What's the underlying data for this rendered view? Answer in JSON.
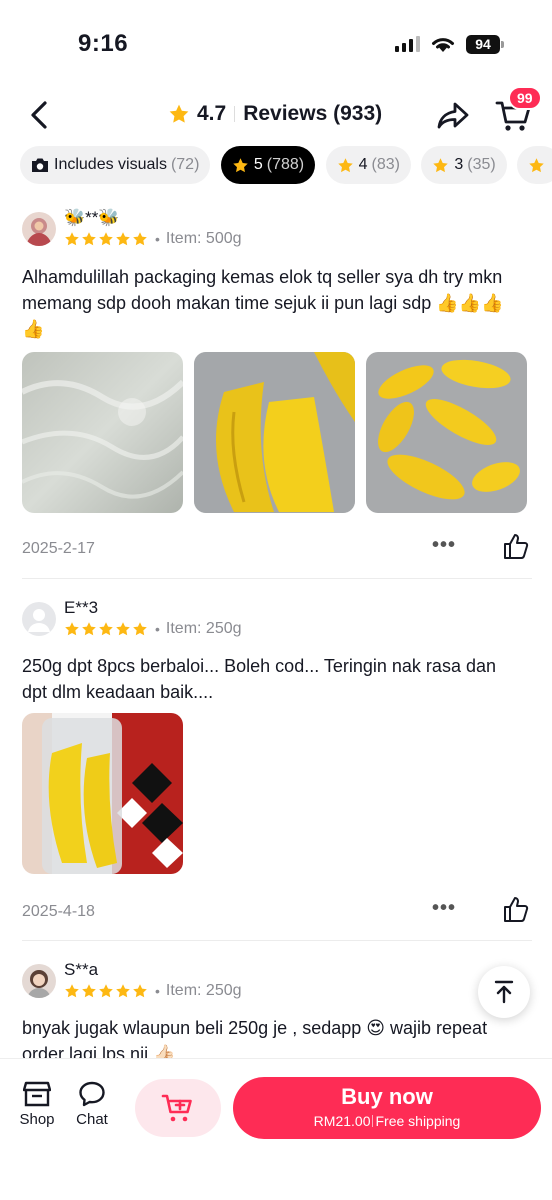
{
  "status": {
    "time": "9:16",
    "battery": "94"
  },
  "header": {
    "rating": "4.7",
    "title": "Reviews (933)",
    "cart_badge": "99"
  },
  "filters": [
    {
      "label": "Includes visuals",
      "count": "(72)"
    },
    {
      "label": "5",
      "count": "(788)"
    },
    {
      "label": "4",
      "count": "(83)"
    },
    {
      "label": "3",
      "count": "(35)"
    }
  ],
  "reviews": [
    {
      "user": "🐝**🐝",
      "item": "Item: 500g",
      "text": "Alhamdulillah packaging kemas elok tq seller sya dh try mkn memang sdp dooh makan time sejuk ii pun lagi sdp 👍👍👍👍",
      "date": "2025-2-17",
      "rating": 5
    },
    {
      "user": "E**3",
      "item": "Item: 250g",
      "text": "250g dpt 8pcs berbaloi... Boleh cod... Teringin nak rasa dan dpt dlm keadaan baik....",
      "date": "2025-4-18",
      "rating": 5
    },
    {
      "user": "S**a",
      "item": "Item: 250g",
      "text": "bnyak jugak wlaupun beli 250g je , sedapp 😍 wajib repeat order lagi lps nii 👍🏻",
      "rating": 5
    }
  ],
  "bottom": {
    "shop": "Shop",
    "chat": "Chat",
    "buy_now": "Buy now",
    "price": "RM21.00",
    "shipping": "Free shipping"
  },
  "colors": {
    "accent": "#fe2c55",
    "star": "#fdb813"
  }
}
